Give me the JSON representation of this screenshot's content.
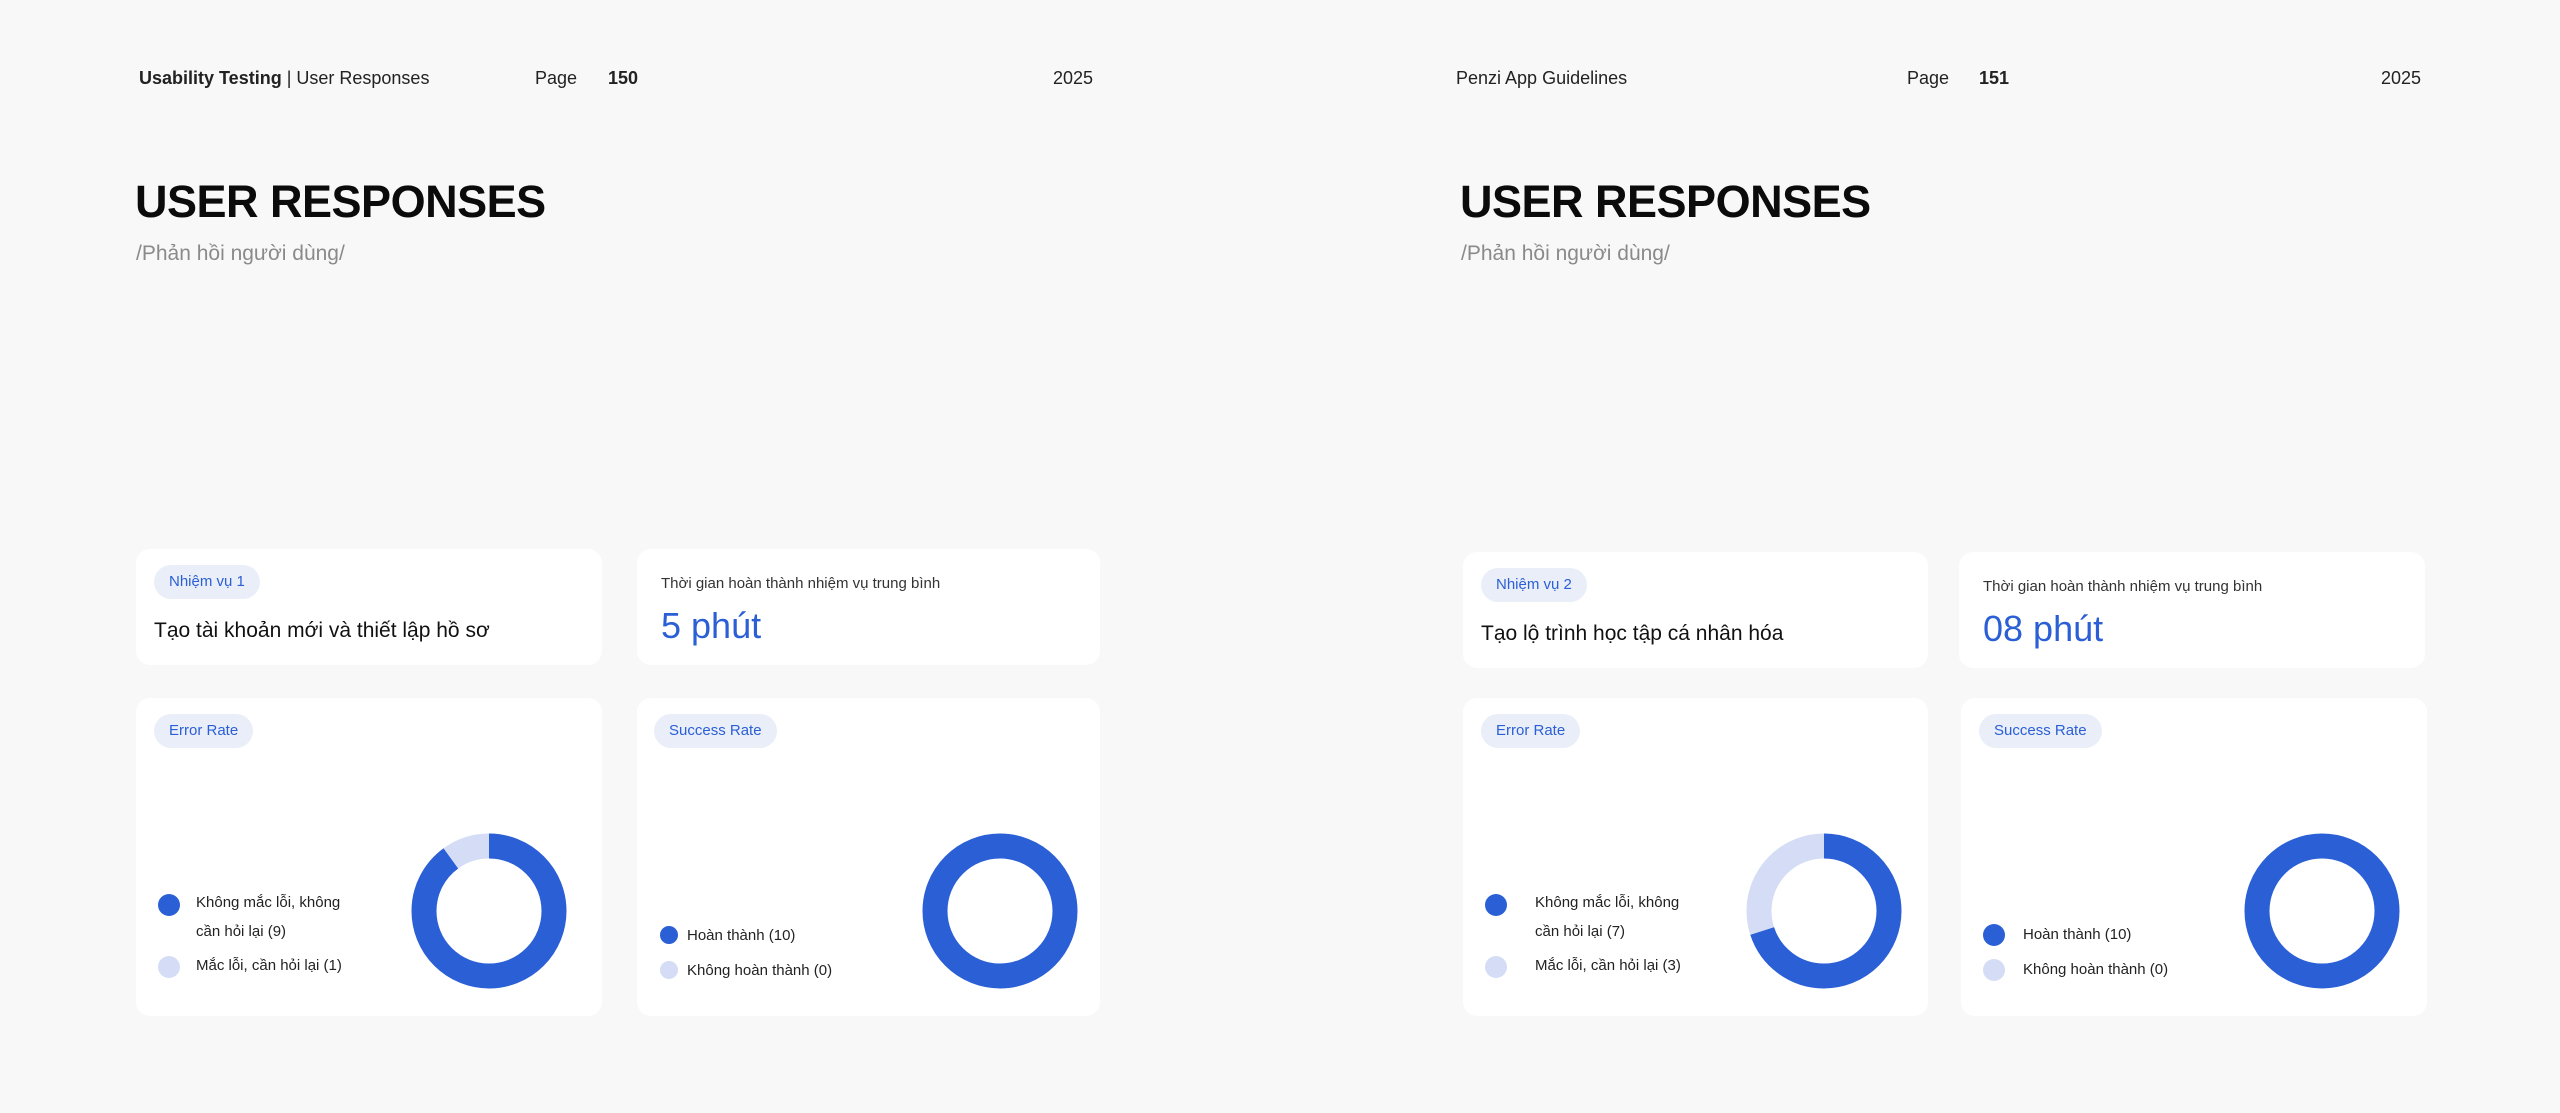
{
  "pages": [
    {
      "header": {
        "title_bold": "Usability Testing",
        "title_rest": " | User Responses",
        "page_label": "Page",
        "page_number": "150",
        "year": "2025"
      },
      "title": "USER RESPONSES",
      "subtitle": "/Phản hồi người dùng/",
      "task": {
        "badge": "Nhiệm vụ 1",
        "name": "Tạo tài khoản mới và thiết lập hồ sơ"
      },
      "avg_time": {
        "label": "Thời gian hoàn thành nhiệm vụ trung bình",
        "value": "5 phút"
      },
      "error_rate": {
        "badge": "Error Rate",
        "legend": [
          "Không mắc lỗi, không",
          "cần hỏi lại (9)",
          "Mắc lỗi, cần hỏi lại (1)"
        ]
      },
      "success_rate": {
        "badge": "Success Rate",
        "legend": [
          "Hoàn thành (10)",
          "Không hoàn thành (0)"
        ]
      }
    },
    {
      "header": {
        "title_bold": "",
        "title_rest": "Penzi App Guidelines",
        "page_label": "Page",
        "page_number": "151",
        "year": "2025"
      },
      "title": "USER RESPONSES",
      "subtitle": "/Phản hồi người dùng/",
      "task": {
        "badge": "Nhiệm vụ 2",
        "name": "Tạo lộ trình học tập cá nhân hóa"
      },
      "avg_time": {
        "label": "Thời gian hoàn thành nhiệm vụ trung bình",
        "value": "08 phút"
      },
      "error_rate": {
        "badge": "Error Rate",
        "legend": [
          "Không mắc lỗi, không",
          "cần hỏi lại (7)",
          "Mắc lỗi, cần hỏi lại (3)"
        ]
      },
      "success_rate": {
        "badge": "Success Rate",
        "legend": [
          "Hoàn thành (10)",
          "Không hoàn thành (0)"
        ]
      }
    }
  ],
  "colors": {
    "primary": "#2b5fd6",
    "secondary": "#d4ddf5"
  },
  "chart_data": [
    {
      "type": "pie",
      "categories": [
        "Không mắc lỗi, không cần hỏi lại",
        "Mắc lỗi, cần hỏi lại"
      ],
      "values": [
        9,
        1
      ]
    },
    {
      "type": "pie",
      "categories": [
        "Hoàn thành",
        "Không hoàn thành"
      ],
      "values": [
        10,
        0
      ]
    },
    {
      "type": "pie",
      "categories": [
        "Không mắc lỗi, không cần hỏi lại",
        "Mắc lỗi, cần hỏi lại"
      ],
      "values": [
        7,
        3
      ]
    },
    {
      "type": "pie",
      "categories": [
        "Hoàn thành",
        "Không hoàn thành"
      ],
      "values": [
        10,
        0
      ]
    }
  ]
}
